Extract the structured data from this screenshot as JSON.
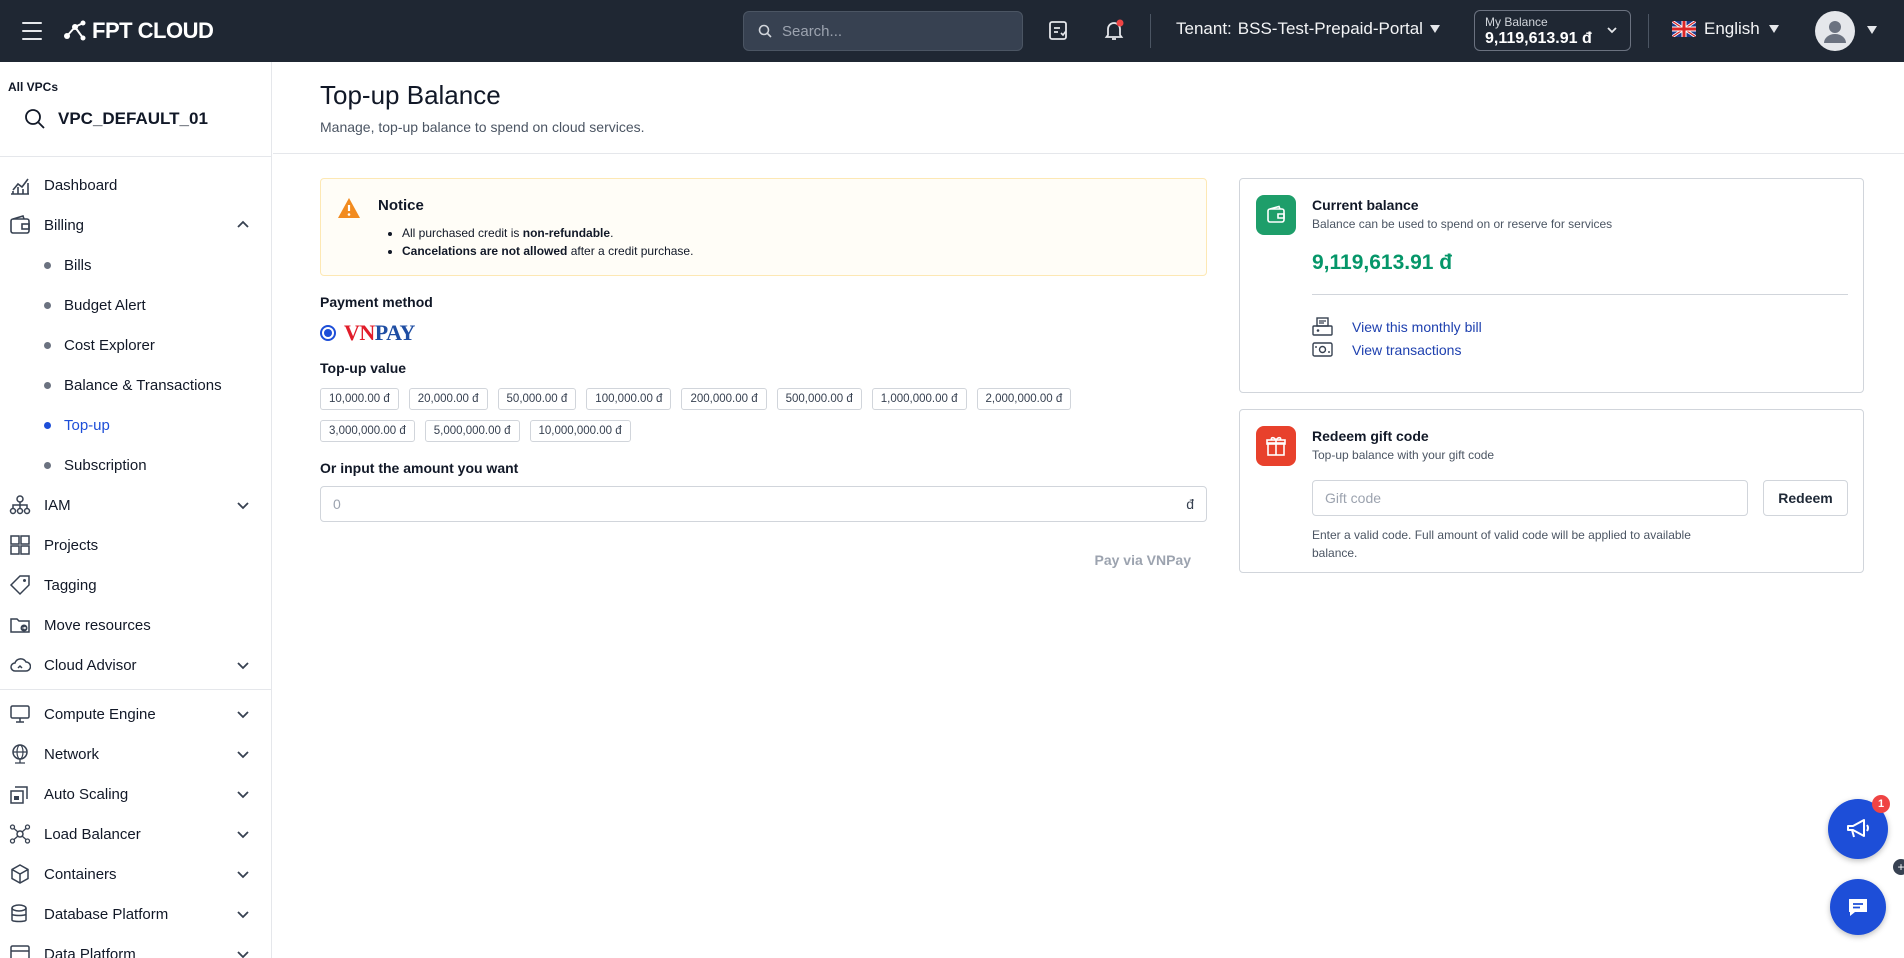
{
  "header": {
    "logo_text": "FPT CLOUD",
    "search_placeholder": "Search...",
    "tenant_label": "Tenant:",
    "tenant_name": "BSS-Test-Prepaid-Portal",
    "balance_label": "My Balance",
    "balance_value": "9,119,613.91 đ",
    "language": "English",
    "notification_color": "#ef4444"
  },
  "sidebar": {
    "vpc_all_label": "All VPCs",
    "vpc_name": "VPC_DEFAULT_01",
    "items": [
      {
        "label": "Dashboard",
        "icon": "dashboard-icon"
      },
      {
        "label": "Billing",
        "icon": "wallet-icon",
        "expanded": true,
        "children": [
          {
            "label": "Bills"
          },
          {
            "label": "Budget Alert"
          },
          {
            "label": "Cost Explorer"
          },
          {
            "label": "Balance & Transactions"
          },
          {
            "label": "Top-up",
            "active": true
          },
          {
            "label": "Subscription"
          }
        ]
      },
      {
        "label": "IAM",
        "icon": "iam-icon"
      },
      {
        "label": "Projects",
        "icon": "projects-icon"
      },
      {
        "label": "Tagging",
        "icon": "tag-icon"
      },
      {
        "label": "Move resources",
        "icon": "move-resources-icon"
      },
      {
        "label": "Cloud Advisor",
        "icon": "cloud-advisor-icon"
      },
      {
        "label": "Compute Engine",
        "icon": "compute-icon"
      },
      {
        "label": "Network",
        "icon": "network-icon"
      },
      {
        "label": "Auto Scaling",
        "icon": "auto-scaling-icon"
      },
      {
        "label": "Load Balancer",
        "icon": "load-balancer-icon"
      },
      {
        "label": "Containers",
        "icon": "containers-icon"
      },
      {
        "label": "Database Platform",
        "icon": "database-icon"
      },
      {
        "label": "Data Platform",
        "icon": "data-platform-icon"
      }
    ]
  },
  "page": {
    "title": "Top-up Balance",
    "subtitle": "Manage, top-up balance to spend on cloud services."
  },
  "notice": {
    "title": "Notice",
    "line1_prefix": "All purchased credit is ",
    "line1_bold": "non-refundable",
    "line1_suffix": ".",
    "line2_bold": "Cancelations are not allowed",
    "line2_suffix": " after a credit purchase."
  },
  "payment": {
    "method_label": "Payment method",
    "method_vn": "VN",
    "method_pay": "PAY",
    "topup_label": "Top-up value",
    "amounts": [
      "10,000.00 đ",
      "20,000.00 đ",
      "50,000.00 đ",
      "100,000.00 đ",
      "200,000.00 đ",
      "500,000.00 đ",
      "1,000,000.00 đ",
      "2,000,000.00 đ",
      "3,000,000.00 đ",
      "5,000,000.00 đ",
      "10,000,000.00 đ"
    ],
    "custom_label": "Or input the amount you want",
    "custom_placeholder": "0",
    "currency": "đ",
    "pay_button": "Pay via VNPay"
  },
  "current_balance": {
    "title": "Current balance",
    "subtitle": "Balance can be used to spend on or reserve for services",
    "value": "9,119,613.91 đ",
    "link_bill": "View this monthly bill",
    "link_transactions": "View transactions",
    "accent": "#059669"
  },
  "gift": {
    "title": "Redeem gift code",
    "subtitle": "Top-up balance with your gift code",
    "placeholder": "Gift code",
    "button": "Redeem",
    "help": "Enter a valid code. Full amount of valid code will be applied to available balance.",
    "accent": "#e8412c"
  },
  "fab": {
    "announcement_badge": "1"
  }
}
